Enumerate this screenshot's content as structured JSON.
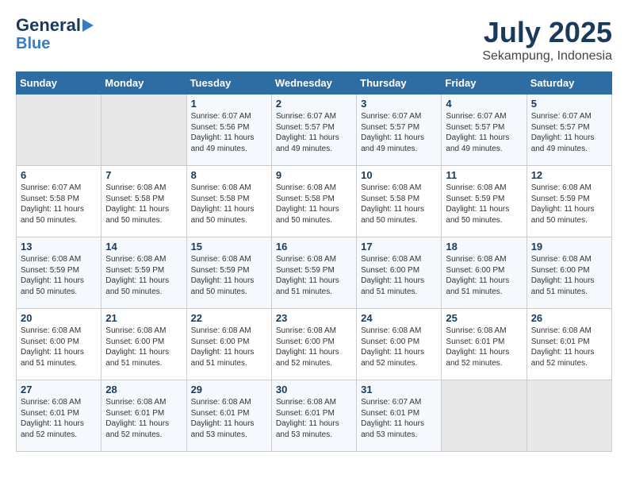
{
  "header": {
    "logo_line1": "General",
    "logo_line2": "Blue",
    "month": "July 2025",
    "location": "Sekampung, Indonesia"
  },
  "weekdays": [
    "Sunday",
    "Monday",
    "Tuesday",
    "Wednesday",
    "Thursday",
    "Friday",
    "Saturday"
  ],
  "weeks": [
    [
      {
        "day": "",
        "info": ""
      },
      {
        "day": "",
        "info": ""
      },
      {
        "day": "1",
        "info": "Sunrise: 6:07 AM\nSunset: 5:56 PM\nDaylight: 11 hours and 49 minutes."
      },
      {
        "day": "2",
        "info": "Sunrise: 6:07 AM\nSunset: 5:57 PM\nDaylight: 11 hours and 49 minutes."
      },
      {
        "day": "3",
        "info": "Sunrise: 6:07 AM\nSunset: 5:57 PM\nDaylight: 11 hours and 49 minutes."
      },
      {
        "day": "4",
        "info": "Sunrise: 6:07 AM\nSunset: 5:57 PM\nDaylight: 11 hours and 49 minutes."
      },
      {
        "day": "5",
        "info": "Sunrise: 6:07 AM\nSunset: 5:57 PM\nDaylight: 11 hours and 49 minutes."
      }
    ],
    [
      {
        "day": "6",
        "info": "Sunrise: 6:07 AM\nSunset: 5:58 PM\nDaylight: 11 hours and 50 minutes."
      },
      {
        "day": "7",
        "info": "Sunrise: 6:08 AM\nSunset: 5:58 PM\nDaylight: 11 hours and 50 minutes."
      },
      {
        "day": "8",
        "info": "Sunrise: 6:08 AM\nSunset: 5:58 PM\nDaylight: 11 hours and 50 minutes."
      },
      {
        "day": "9",
        "info": "Sunrise: 6:08 AM\nSunset: 5:58 PM\nDaylight: 11 hours and 50 minutes."
      },
      {
        "day": "10",
        "info": "Sunrise: 6:08 AM\nSunset: 5:58 PM\nDaylight: 11 hours and 50 minutes."
      },
      {
        "day": "11",
        "info": "Sunrise: 6:08 AM\nSunset: 5:59 PM\nDaylight: 11 hours and 50 minutes."
      },
      {
        "day": "12",
        "info": "Sunrise: 6:08 AM\nSunset: 5:59 PM\nDaylight: 11 hours and 50 minutes."
      }
    ],
    [
      {
        "day": "13",
        "info": "Sunrise: 6:08 AM\nSunset: 5:59 PM\nDaylight: 11 hours and 50 minutes."
      },
      {
        "day": "14",
        "info": "Sunrise: 6:08 AM\nSunset: 5:59 PM\nDaylight: 11 hours and 50 minutes."
      },
      {
        "day": "15",
        "info": "Sunrise: 6:08 AM\nSunset: 5:59 PM\nDaylight: 11 hours and 50 minutes."
      },
      {
        "day": "16",
        "info": "Sunrise: 6:08 AM\nSunset: 5:59 PM\nDaylight: 11 hours and 51 minutes."
      },
      {
        "day": "17",
        "info": "Sunrise: 6:08 AM\nSunset: 6:00 PM\nDaylight: 11 hours and 51 minutes."
      },
      {
        "day": "18",
        "info": "Sunrise: 6:08 AM\nSunset: 6:00 PM\nDaylight: 11 hours and 51 minutes."
      },
      {
        "day": "19",
        "info": "Sunrise: 6:08 AM\nSunset: 6:00 PM\nDaylight: 11 hours and 51 minutes."
      }
    ],
    [
      {
        "day": "20",
        "info": "Sunrise: 6:08 AM\nSunset: 6:00 PM\nDaylight: 11 hours and 51 minutes."
      },
      {
        "day": "21",
        "info": "Sunrise: 6:08 AM\nSunset: 6:00 PM\nDaylight: 11 hours and 51 minutes."
      },
      {
        "day": "22",
        "info": "Sunrise: 6:08 AM\nSunset: 6:00 PM\nDaylight: 11 hours and 51 minutes."
      },
      {
        "day": "23",
        "info": "Sunrise: 6:08 AM\nSunset: 6:00 PM\nDaylight: 11 hours and 52 minutes."
      },
      {
        "day": "24",
        "info": "Sunrise: 6:08 AM\nSunset: 6:00 PM\nDaylight: 11 hours and 52 minutes."
      },
      {
        "day": "25",
        "info": "Sunrise: 6:08 AM\nSunset: 6:01 PM\nDaylight: 11 hours and 52 minutes."
      },
      {
        "day": "26",
        "info": "Sunrise: 6:08 AM\nSunset: 6:01 PM\nDaylight: 11 hours and 52 minutes."
      }
    ],
    [
      {
        "day": "27",
        "info": "Sunrise: 6:08 AM\nSunset: 6:01 PM\nDaylight: 11 hours and 52 minutes."
      },
      {
        "day": "28",
        "info": "Sunrise: 6:08 AM\nSunset: 6:01 PM\nDaylight: 11 hours and 52 minutes."
      },
      {
        "day": "29",
        "info": "Sunrise: 6:08 AM\nSunset: 6:01 PM\nDaylight: 11 hours and 53 minutes."
      },
      {
        "day": "30",
        "info": "Sunrise: 6:08 AM\nSunset: 6:01 PM\nDaylight: 11 hours and 53 minutes."
      },
      {
        "day": "31",
        "info": "Sunrise: 6:07 AM\nSunset: 6:01 PM\nDaylight: 11 hours and 53 minutes."
      },
      {
        "day": "",
        "info": ""
      },
      {
        "day": "",
        "info": ""
      }
    ]
  ]
}
